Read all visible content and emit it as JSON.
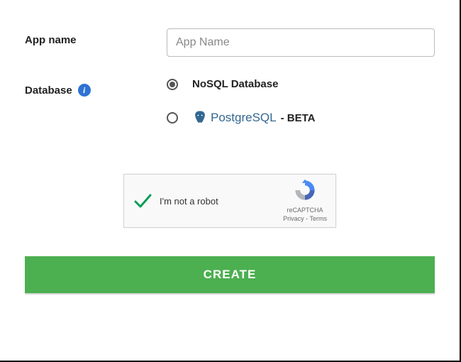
{
  "form": {
    "app_name_label": "App name",
    "app_name_placeholder": "App Name",
    "app_name_value": "",
    "database_label": "Database",
    "options": {
      "nosql": {
        "label": "NoSQL Database",
        "selected": true
      },
      "postgres": {
        "brand": "PostgreSQL",
        "suffix": " - BETA",
        "selected": false
      }
    }
  },
  "recaptcha": {
    "text": "I'm not a robot",
    "brand": "reCAPTCHA",
    "privacy": "Privacy",
    "terms": "Terms",
    "checked": true
  },
  "actions": {
    "create": "CREATE"
  },
  "colors": {
    "accent_green": "#4caf50",
    "info_blue": "#2d73d2",
    "postgres_blue": "#336791"
  }
}
